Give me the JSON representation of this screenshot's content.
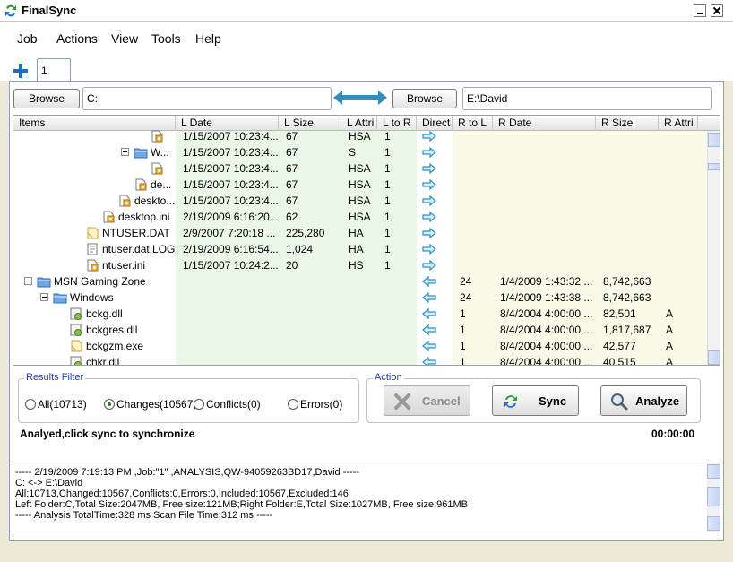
{
  "app": {
    "title": "FinalSync"
  },
  "menu": [
    "Job",
    "Actions",
    "View",
    "Tools",
    "Help"
  ],
  "tabs": [
    {
      "label": "1"
    }
  ],
  "left_path": {
    "browse_label": "Browse",
    "value": "C:"
  },
  "right_path": {
    "browse_label": "Browse",
    "value": "E:\\David"
  },
  "columns": [
    "Items",
    "L Date",
    "L Size",
    "L Attri",
    "L to R",
    "Direct",
    "R to L",
    "R Date",
    "R Size",
    "R Attri"
  ],
  "rows": [
    {
      "indent": 8,
      "icon": "file",
      "name": "",
      "l_date": "1/15/2007 10:23:4...",
      "l_size": "67",
      "l_attr": "HSA",
      "l_to_r": "1",
      "dir": "right",
      "r_to_l": "",
      "r_date": "",
      "r_size": "",
      "r_attr": ""
    },
    {
      "indent": 7,
      "icon": "folder",
      "expander": true,
      "name": "W...",
      "l_date": "1/15/2007 10:23:4...",
      "l_size": "67",
      "l_attr": "S",
      "l_to_r": "1",
      "dir": "right",
      "r_to_l": "",
      "r_date": "",
      "r_size": "",
      "r_attr": ""
    },
    {
      "indent": 8,
      "icon": "file",
      "name": "",
      "l_date": "1/15/2007 10:23:4...",
      "l_size": "67",
      "l_attr": "HSA",
      "l_to_r": "1",
      "dir": "right",
      "r_to_l": "",
      "r_date": "",
      "r_size": "",
      "r_attr": ""
    },
    {
      "indent": 7,
      "icon": "file",
      "name": "de...",
      "l_date": "1/15/2007 10:23:4...",
      "l_size": "67",
      "l_attr": "HSA",
      "l_to_r": "1",
      "dir": "right",
      "r_to_l": "",
      "r_date": "",
      "r_size": "",
      "r_attr": ""
    },
    {
      "indent": 6,
      "icon": "file",
      "name": "deskto...",
      "l_date": "1/15/2007 10:23:4...",
      "l_size": "67",
      "l_attr": "HSA",
      "l_to_r": "1",
      "dir": "right",
      "r_to_l": "",
      "r_date": "",
      "r_size": "",
      "r_attr": ""
    },
    {
      "indent": 5,
      "icon": "file",
      "name": "desktop.ini",
      "l_date": "2/19/2009 6:16:20...",
      "l_size": "62",
      "l_attr": "HSA",
      "l_to_r": "1",
      "dir": "right",
      "r_to_l": "",
      "r_date": "",
      "r_size": "",
      "r_attr": ""
    },
    {
      "indent": 4,
      "icon": "dat",
      "name": "NTUSER.DAT",
      "l_date": "2/9/2007 7:20:18 ...",
      "l_size": "225,280",
      "l_attr": "HA",
      "l_to_r": "1",
      "dir": "right",
      "r_to_l": "",
      "r_date": "",
      "r_size": "",
      "r_attr": ""
    },
    {
      "indent": 4,
      "icon": "log",
      "name": "ntuser.dat.LOG",
      "l_date": "2/19/2009 6:16:54...",
      "l_size": "1,024",
      "l_attr": "HA",
      "l_to_r": "1",
      "dir": "right",
      "r_to_l": "",
      "r_date": "",
      "r_size": "",
      "r_attr": ""
    },
    {
      "indent": 4,
      "icon": "file",
      "name": "ntuser.ini",
      "l_date": "1/15/2007 10:24:2...",
      "l_size": "20",
      "l_attr": "HS",
      "l_to_r": "1",
      "dir": "right",
      "r_to_l": "",
      "r_date": "",
      "r_size": "",
      "r_attr": ""
    },
    {
      "indent": 1,
      "icon": "folder",
      "expander": true,
      "name": "MSN Gaming Zone",
      "l_date": "",
      "l_size": "",
      "l_attr": "",
      "l_to_r": "",
      "dir": "left",
      "r_to_l": "24",
      "r_date": "1/4/2009 1:43:32 ...",
      "r_size": "8,742,663",
      "r_attr": ""
    },
    {
      "indent": 2,
      "icon": "folder",
      "expander": true,
      "name": "Windows",
      "l_date": "",
      "l_size": "",
      "l_attr": "",
      "l_to_r": "",
      "dir": "left",
      "r_to_l": "24",
      "r_date": "1/4/2009 1:43:38 ...",
      "r_size": "8,742,663",
      "r_attr": ""
    },
    {
      "indent": 3,
      "icon": "dll",
      "name": "bckg.dll",
      "l_date": "",
      "l_size": "",
      "l_attr": "",
      "l_to_r": "",
      "dir": "left",
      "r_to_l": "1",
      "r_date": "8/4/2004 4:00:00 ...",
      "r_size": "82,501",
      "r_attr": "A"
    },
    {
      "indent": 3,
      "icon": "dll",
      "name": "bckgres.dll",
      "l_date": "",
      "l_size": "",
      "l_attr": "",
      "l_to_r": "",
      "dir": "left",
      "r_to_l": "1",
      "r_date": "8/4/2004 4:00:00 ...",
      "r_size": "1,817,687",
      "r_attr": "A"
    },
    {
      "indent": 3,
      "icon": "dat",
      "name": "bckgzm.exe",
      "l_date": "",
      "l_size": "",
      "l_attr": "",
      "l_to_r": "",
      "dir": "left",
      "r_to_l": "1",
      "r_date": "8/4/2004 4:00:00 ...",
      "r_size": "42,577",
      "r_attr": "A"
    },
    {
      "indent": 3,
      "icon": "dll",
      "name": "chkr.dll",
      "l_date": "",
      "l_size": "",
      "l_attr": "",
      "l_to_r": "",
      "dir": "left",
      "r_to_l": "1",
      "r_date": "8/4/2004 4:00:00 ...",
      "r_size": "40,515",
      "r_attr": "A"
    }
  ],
  "filter": {
    "legend": "Results Filter",
    "options": [
      {
        "label": "All(10713)",
        "selected": false
      },
      {
        "label": "Changes(10567)",
        "selected": true
      },
      {
        "label": "Conflicts(0)",
        "selected": false
      },
      {
        "label": "Errors(0)",
        "selected": false
      }
    ]
  },
  "action": {
    "legend": "Action",
    "cancel_label": "Cancel",
    "sync_label": "Sync",
    "analyze_label": "Analyze"
  },
  "status": {
    "message": "Analyed,click sync to synchronize",
    "timer": "00:00:00"
  },
  "log": [
    "----- 2/19/2009 7:19:13 PM ,Job:\"1\" ,ANALYSIS,QW-94059263BD17,David -----",
    "C: <-> E:\\David",
    "All:10713,Changed:10567,Conflicts:0,Errors:0,Included:10567,Excluded:146",
    "Left Folder:C,Total Size:2047MB, Free size:121MB;Right Folder:E,Total Size:1027MB, Free size:961MB",
    "----- Analysis TotalTime:328 ms Scan File Time:312 ms -----"
  ],
  "colors": {
    "accent": "#2e8fbf",
    "left_fill": "#eaf6e6",
    "right_fill": "#f8f9e6"
  }
}
